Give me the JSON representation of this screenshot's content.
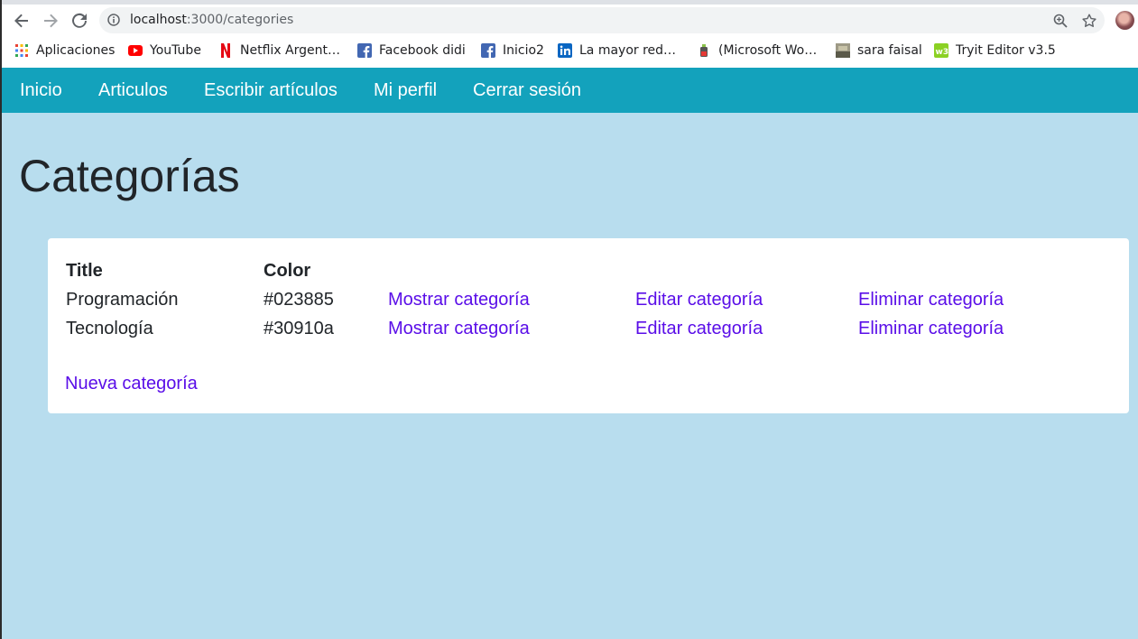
{
  "browser": {
    "url_host": "localhost",
    "url_path": ":3000/categories",
    "bookmarks": [
      {
        "label": "Aplicaciones",
        "icon": "apps-grid-icon"
      },
      {
        "label": "YouTube",
        "icon": "youtube-icon"
      },
      {
        "label": "Netflix Argent…",
        "icon": "netflix-icon"
      },
      {
        "label": "Facebook didi",
        "icon": "facebook-icon"
      },
      {
        "label": "Inicio2",
        "icon": "facebook-icon"
      },
      {
        "label": "La mayor red…",
        "icon": "linkedin-icon"
      },
      {
        "label": "(Microsoft Wo…",
        "icon": "generic-favicon-icon"
      },
      {
        "label": "sara faisal",
        "icon": "image-favicon-icon"
      },
      {
        "label": "Tryit Editor v3.5",
        "icon": "w3schools-icon"
      }
    ]
  },
  "nav": {
    "items": [
      {
        "label": "Inicio"
      },
      {
        "label": "Articulos"
      },
      {
        "label": "Escribir artículos"
      },
      {
        "label": "Mi perfil"
      },
      {
        "label": "Cerrar sesión"
      }
    ]
  },
  "page": {
    "title": "Categorías"
  },
  "table": {
    "headers": [
      "Title",
      "Color"
    ],
    "rows": [
      {
        "title": "Programación",
        "color": "#023885",
        "show": "Mostrar categoría",
        "edit": "Editar categoría",
        "delete": "Eliminar categoría"
      },
      {
        "title": "Tecnología",
        "color": "#30910a",
        "show": "Mostrar categoría",
        "edit": "Editar categoría",
        "delete": "Eliminar categoría"
      }
    ]
  },
  "new_link": "Nueva categoría",
  "colors": {
    "navbar": "#13a2bc",
    "page_bg": "#b8ddee",
    "link": "#5a0ee8"
  }
}
